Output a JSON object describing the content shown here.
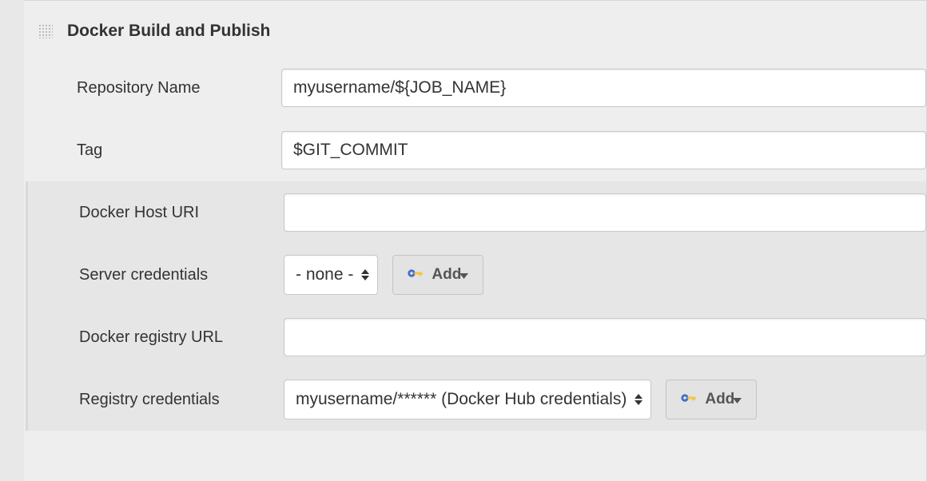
{
  "section": {
    "title": "Docker Build and Publish"
  },
  "fields": {
    "repository_name": {
      "label": "Repository Name",
      "value": "myusername/${JOB_NAME}"
    },
    "tag": {
      "label": "Tag",
      "value": "$GIT_COMMIT"
    },
    "docker_host_uri": {
      "label": "Docker Host URI",
      "value": ""
    },
    "server_credentials": {
      "label": "Server credentials",
      "selected": "- none -",
      "add_label": "Add"
    },
    "docker_registry_url": {
      "label": "Docker registry URL",
      "value": ""
    },
    "registry_credentials": {
      "label": "Registry credentials",
      "selected": "myusername/****** (Docker Hub credentials)",
      "add_label": "Add"
    }
  }
}
